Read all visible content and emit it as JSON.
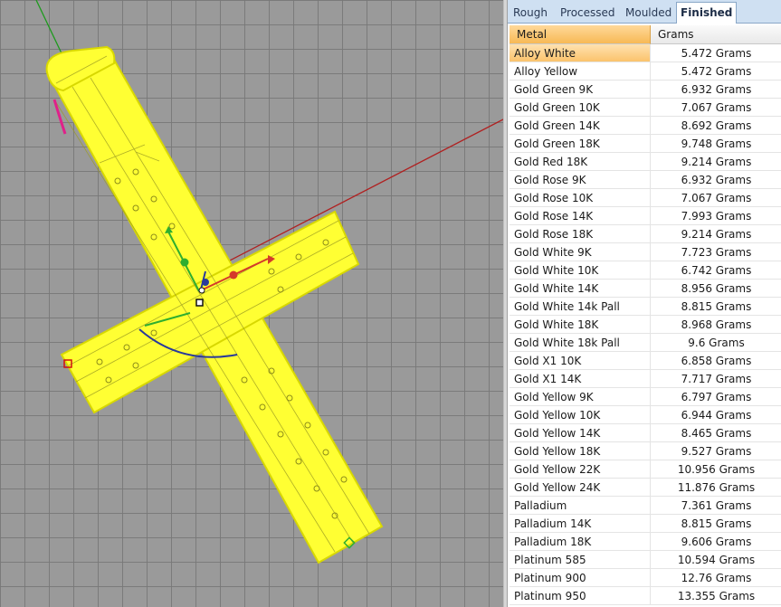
{
  "tabs": [
    {
      "label": "Rough"
    },
    {
      "label": "Processed"
    },
    {
      "label": "Moulded"
    },
    {
      "label": "Finished"
    }
  ],
  "active_tab": "Finished",
  "table": {
    "columns": [
      "Metal",
      "Grams"
    ],
    "selected_row": 0,
    "rows": [
      {
        "metal": "Alloy White",
        "grams": "5.472 Grams"
      },
      {
        "metal": "Alloy Yellow",
        "grams": "5.472 Grams"
      },
      {
        "metal": "Gold Green 9K",
        "grams": "6.932 Grams"
      },
      {
        "metal": "Gold Green 10K",
        "grams": "7.067 Grams"
      },
      {
        "metal": "Gold Green 14K",
        "grams": "8.692 Grams"
      },
      {
        "metal": "Gold Green 18K",
        "grams": "9.748 Grams"
      },
      {
        "metal": "Gold Red 18K",
        "grams": "9.214 Grams"
      },
      {
        "metal": "Gold Rose 9K",
        "grams": "6.932 Grams"
      },
      {
        "metal": "Gold Rose 10K",
        "grams": "7.067 Grams"
      },
      {
        "metal": "Gold Rose 14K",
        "grams": "7.993 Grams"
      },
      {
        "metal": "Gold Rose 18K",
        "grams": "9.214 Grams"
      },
      {
        "metal": "Gold White 9K",
        "grams": "7.723 Grams"
      },
      {
        "metal": "Gold White 10K",
        "grams": "6.742 Grams"
      },
      {
        "metal": "Gold White 14K",
        "grams": "8.956 Grams"
      },
      {
        "metal": "Gold White 14k Pall",
        "grams": "8.815 Grams"
      },
      {
        "metal": "Gold White 18K",
        "grams": "8.968 Grams"
      },
      {
        "metal": "Gold White 18k Pall",
        "grams": "9.6 Grams"
      },
      {
        "metal": "Gold X1 10K",
        "grams": "6.858 Grams"
      },
      {
        "metal": "Gold X1 14K",
        "grams": "7.717 Grams"
      },
      {
        "metal": "Gold Yellow 9K",
        "grams": "6.797 Grams"
      },
      {
        "metal": "Gold Yellow 10K",
        "grams": "6.944 Grams"
      },
      {
        "metal": "Gold Yellow 14K",
        "grams": "8.465 Grams"
      },
      {
        "metal": "Gold Yellow 18K",
        "grams": "9.527 Grams"
      },
      {
        "metal": "Gold Yellow 22K",
        "grams": "10.956 Grams"
      },
      {
        "metal": "Gold Yellow 24K",
        "grams": "11.876 Grams"
      },
      {
        "metal": "Palladium",
        "grams": "7.361 Grams"
      },
      {
        "metal": "Palladium 14K",
        "grams": "8.815 Grams"
      },
      {
        "metal": "Palladium 18K",
        "grams": "9.606 Grams"
      },
      {
        "metal": "Platinum 585",
        "grams": "10.594 Grams"
      },
      {
        "metal": "Platinum 900",
        "grams": "12.76 Grams"
      },
      {
        "metal": "Platinum 950",
        "grams": "13.355 Grams"
      }
    ]
  },
  "colors": {
    "model": "#ffff33",
    "selected_row": "#fbc36c",
    "tab_strip": "#cfe0f2",
    "axis_x": "#c0392b",
    "axis_y": "#2e9e2e",
    "viewport_bg": "#9a9a9a"
  }
}
